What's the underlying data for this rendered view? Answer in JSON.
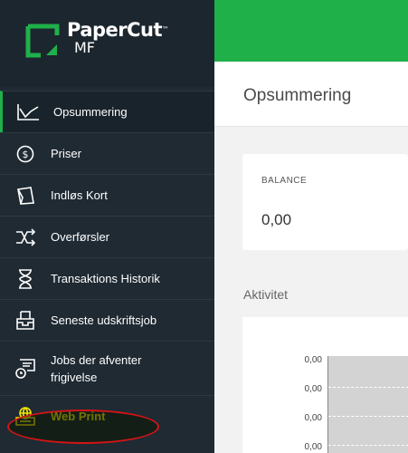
{
  "logo": {
    "name": "PaperCut",
    "tm": "™",
    "sub": "MF"
  },
  "sidebar": {
    "items": [
      {
        "label": "Opsummering",
        "icon": "chart-line-icon"
      },
      {
        "label": "Priser",
        "icon": "dollar-icon"
      },
      {
        "label": "Indløs Kort",
        "icon": "card-icon"
      },
      {
        "label": "Overførsler",
        "icon": "transfer-icon"
      },
      {
        "label": "Transaktions Historik",
        "icon": "hourglass-icon"
      },
      {
        "label": "Seneste udskriftsjob",
        "icon": "printer-tray-icon"
      },
      {
        "label": "Jobs der afventer frigivelse",
        "icon": "pending-print-icon"
      },
      {
        "label": "Web Print",
        "icon": "web-print-icon"
      }
    ]
  },
  "page": {
    "title": "Opsummering"
  },
  "balance": {
    "label": "BALANCE",
    "value": "0,00"
  },
  "activity": {
    "title": "Aktivitet",
    "ticks": [
      "0,00",
      "0,00",
      "0,00",
      "0,00"
    ]
  },
  "colors": {
    "brand": "#1fb04a",
    "sidebar": "#1f2a33",
    "highlight": "#f3e600",
    "annotation": "#d41414"
  }
}
